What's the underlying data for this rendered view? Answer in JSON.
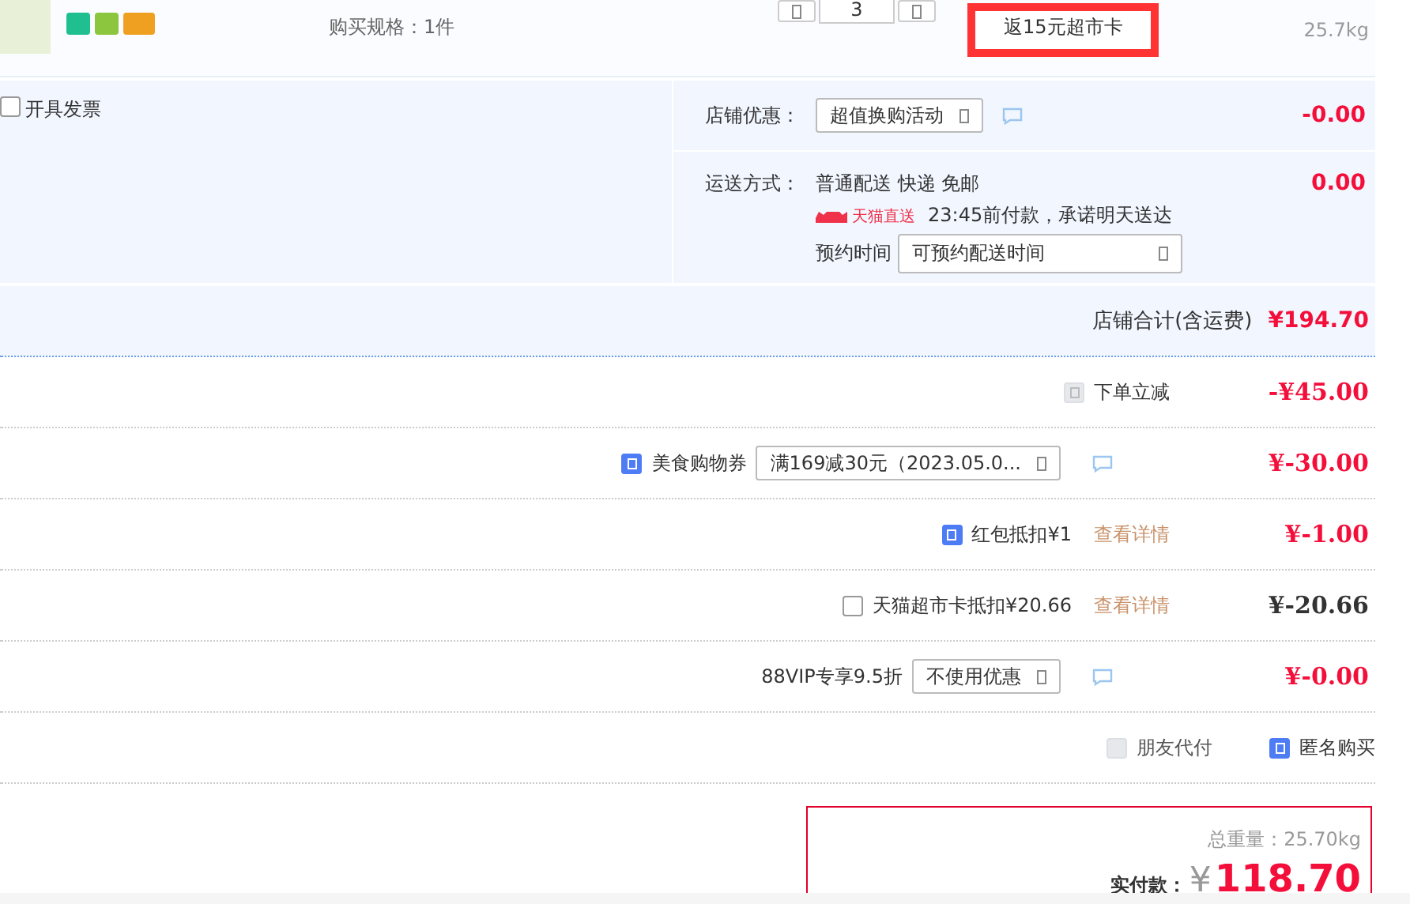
{
  "product": {
    "spec": "购买规格：1件",
    "quantity": "3",
    "rebate": "返15元超市卡",
    "weight": "25.7kg"
  },
  "shop": {
    "invoice": {
      "label": "开具发票",
      "checked": false
    },
    "promotion": {
      "label": "店铺优惠：",
      "option": "超值换购活动",
      "amount": "-0.00"
    },
    "shipping": {
      "label": "运送方式：",
      "method": "普通配送 快递 免邮",
      "badge": "天猫直送",
      "promise": "23:45前付款，承诺明天送达",
      "schedule_label": "预约时间",
      "schedule_option": "可预约配送时间",
      "amount": "0.00"
    }
  },
  "store_total": {
    "label": "店铺合计(含运费)",
    "amount": "¥194.70"
  },
  "discounts": [
    {
      "kind": "check",
      "label": "下单立减",
      "checked": true,
      "disabled": true,
      "amount": "-¥45.00"
    },
    {
      "kind": "select",
      "label": "美食购物券",
      "checked": true,
      "option": "满169减30元（2023.05.0...",
      "amount": "¥-30.00"
    },
    {
      "kind": "check",
      "label": "红包抵扣¥1",
      "checked": true,
      "link": "查看详情",
      "amount": "¥-1.00"
    },
    {
      "kind": "check",
      "label": "天猫超市卡抵扣¥20.66",
      "checked": false,
      "link": "查看详情",
      "amount": "¥-20.66"
    },
    {
      "kind": "select",
      "label": "88VIP专享9.5折",
      "option": "不使用优惠",
      "amount": "¥-0.00"
    }
  ],
  "options": [
    {
      "label": "朋友代付",
      "checked": false,
      "disabled": true
    },
    {
      "label": "匿名购买",
      "checked": true
    }
  ],
  "summary": {
    "weight": "总重量：25.70kg",
    "pay_label": "实付款：",
    "currency": "¥",
    "total": "118.70"
  }
}
